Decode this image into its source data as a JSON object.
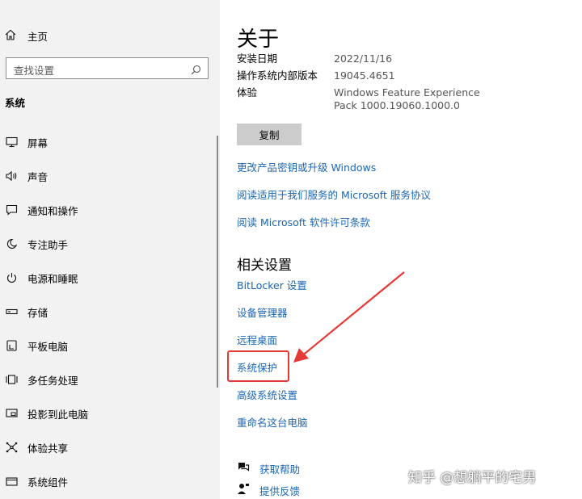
{
  "sidebar": {
    "home_label": "主页",
    "search_placeholder": "查找设置",
    "section_title": "系统",
    "items": [
      {
        "label": "屏幕",
        "icon": "monitor-icon"
      },
      {
        "label": "声音",
        "icon": "speaker-icon"
      },
      {
        "label": "通知和操作",
        "icon": "notification-icon"
      },
      {
        "label": "专注助手",
        "icon": "moon-icon"
      },
      {
        "label": "电源和睡眠",
        "icon": "power-icon"
      },
      {
        "label": "存储",
        "icon": "storage-icon"
      },
      {
        "label": "平板电脑",
        "icon": "tablet-icon"
      },
      {
        "label": "多任务处理",
        "icon": "multitask-icon"
      },
      {
        "label": "投影到此电脑",
        "icon": "project-icon"
      },
      {
        "label": "体验共享",
        "icon": "share-icon"
      },
      {
        "label": "系统组件",
        "icon": "components-icon"
      }
    ]
  },
  "main": {
    "title": "关于",
    "info": [
      {
        "key": "安装日期",
        "value": "2022/11/16"
      },
      {
        "key": "操作系统内部版本",
        "value": "19045.4651"
      },
      {
        "key": "体验",
        "value": "Windows Feature Experience Pack 1000.19060.1000.0"
      }
    ],
    "copy_label": "复制",
    "links": [
      "更改产品密钥或升级 Windows",
      "阅读适用于我们服务的 Microsoft 服务协议",
      "阅读 Microsoft 软件许可条款"
    ],
    "related_title": "相关设置",
    "related_links": [
      "BitLocker 设置",
      "设备管理器",
      "远程桌面",
      "系统保护",
      "高级系统设置",
      "重命名这台电脑"
    ],
    "help_links": [
      {
        "label": "获取帮助",
        "icon": "help-icon"
      },
      {
        "label": "提供反馈",
        "icon": "feedback-icon"
      }
    ]
  },
  "watermark": "知乎 @想躺平的宅男",
  "colors": {
    "link": "#1a66b3",
    "highlight": "#e53935",
    "sidebar_bg": "#f2f2f2"
  }
}
